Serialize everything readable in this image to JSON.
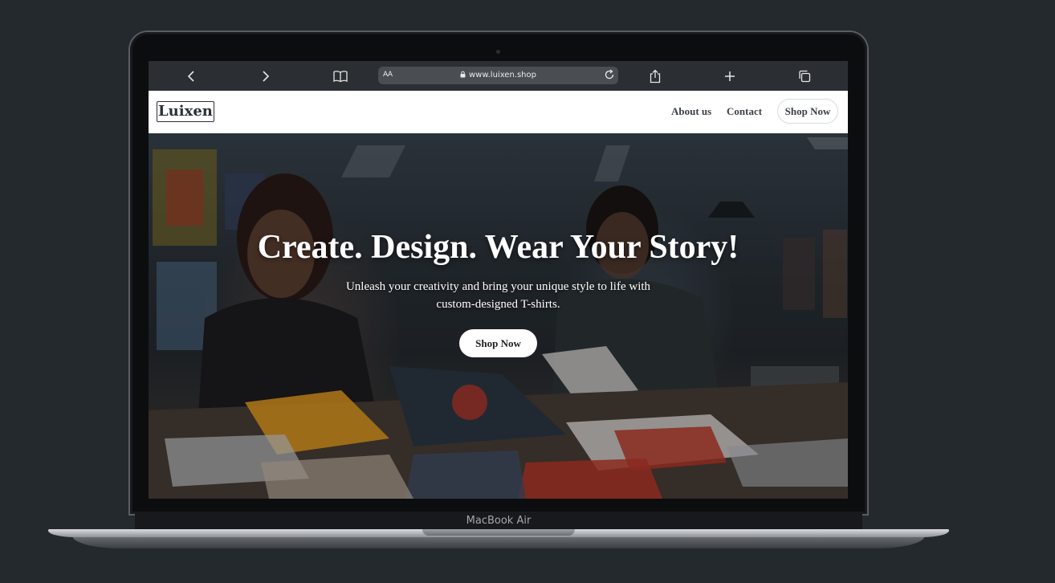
{
  "device": {
    "label": "MacBook Air"
  },
  "browser": {
    "reader_label": "AA",
    "url": "www.luixen.shop",
    "icons": [
      "back-icon",
      "forward-icon",
      "bookmarks-icon",
      "lock-icon",
      "reload-icon",
      "share-icon",
      "new-tab-icon",
      "tabs-icon"
    ]
  },
  "site": {
    "logo": "Luixen",
    "nav": {
      "about": "About us",
      "contact": "Contact",
      "cta": "Shop Now"
    },
    "hero": {
      "title": "Create. Design. Wear Your Story!",
      "subtitle": "Unleash your creativity and bring your unique style to life with custom-designed T-shirts.",
      "cta": "Shop Now"
    }
  }
}
